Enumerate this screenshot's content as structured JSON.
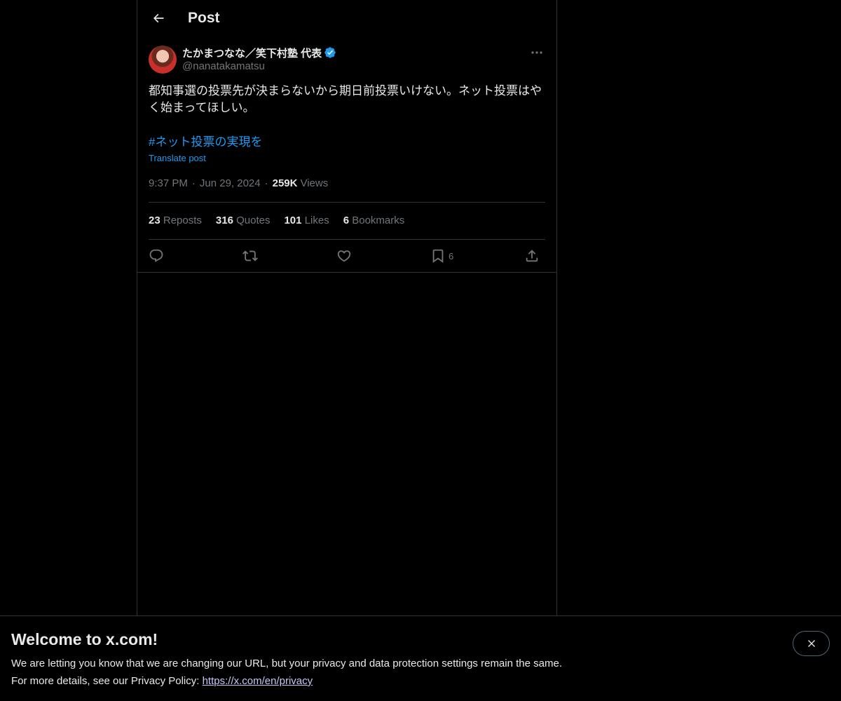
{
  "header": {
    "title": "Post"
  },
  "author": {
    "display_name": "たかまつなな／笑下村塾 代表",
    "handle": "@nanatakamatsu",
    "verified": true
  },
  "post": {
    "text": "都知事選の投票先が決まらないから期日前投票いけない。ネット投票はやく始まってほしい。",
    "hashtag": "#ネット投票の実現を",
    "translate_label": "Translate post",
    "time": "9:37 PM",
    "date": "Jun 29, 2024",
    "views_count": "259K",
    "views_label": "Views",
    "separator": "·"
  },
  "stats": [
    {
      "num": "23",
      "label": "Reposts"
    },
    {
      "num": "316",
      "label": "Quotes"
    },
    {
      "num": "101",
      "label": "Likes"
    },
    {
      "num": "6",
      "label": "Bookmarks"
    }
  ],
  "actions": {
    "bookmark_count": "6"
  },
  "icons": [
    "back-arrow-icon",
    "verified-badge-icon",
    "more-icon",
    "reply-icon",
    "repost-icon",
    "like-icon",
    "bookmark-icon",
    "share-icon",
    "close-icon"
  ],
  "colors": {
    "accent": "#1d9bf0",
    "text": "#e7e9ea",
    "muted": "#71767b",
    "border": "#2f3336",
    "background": "#000000"
  },
  "banner": {
    "title": "Welcome to x.com!",
    "line1": "We are letting you know that we are changing our URL, but your privacy and data protection settings remain the same.",
    "line2_prefix": "For more details, see our Privacy Policy: ",
    "link": "https://x.com/en/privacy"
  }
}
